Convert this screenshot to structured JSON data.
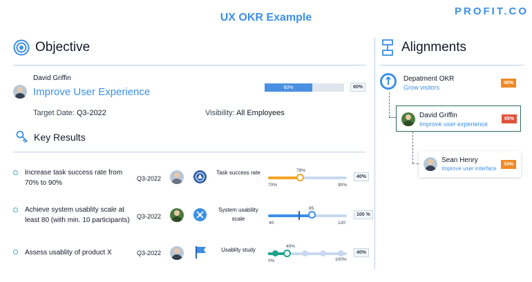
{
  "header": {
    "title": "UX OKR Example",
    "logo": "PROFIT.CO"
  },
  "objective": {
    "section_title": "Objective",
    "owner": "David Griffin",
    "title": "Improve User Experience",
    "progress_pct": 60,
    "progress_label": "60%",
    "progress_badge": "60%",
    "target_label": "Target Date:",
    "target_value": "Q3-2022",
    "visibility_label": "Visibility:",
    "visibility_value": "All Employees"
  },
  "key_results": {
    "section_title": "Key Results",
    "items": [
      {
        "text": "Increase task success rate from 70% to 90%",
        "quarter": "Q3-2022",
        "metric": "Task success rate",
        "min": "70%",
        "max": "90%",
        "current": "78%",
        "progress_pct": 40,
        "badge": "40%"
      },
      {
        "text": "Achieve system usablity scale at least 80 (with min. 10 participants)",
        "quarter": "Q3-2022",
        "metric": "System usability scale",
        "min": "40",
        "max": "120",
        "current": "85",
        "progress_pct": 100,
        "badge": "100 %"
      },
      {
        "text": "Assess usablity of product X",
        "quarter": "Q3-2022",
        "metric": "Usablity study",
        "min": "0%",
        "max": "100%",
        "current": "40%",
        "progress_pct": 40,
        "badge": "40%"
      }
    ]
  },
  "alignments": {
    "section_title": "Alignments",
    "items": [
      {
        "name": "Depatment OKR",
        "subtitle": "Grow visitors",
        "badge": "40%",
        "badge_color": "#f08a24"
      },
      {
        "name": "David Griffin",
        "subtitle": "Improve user experience",
        "badge": "65%",
        "badge_color": "#e0533d"
      },
      {
        "name": "Sean Henry",
        "subtitle": "Improve user interface",
        "badge": "34%",
        "badge_color": "#f08a24"
      }
    ]
  },
  "colors": {
    "accent": "#3b8fe6",
    "teal": "#1aa38c",
    "orange": "#f08a24",
    "red": "#e0533d"
  }
}
